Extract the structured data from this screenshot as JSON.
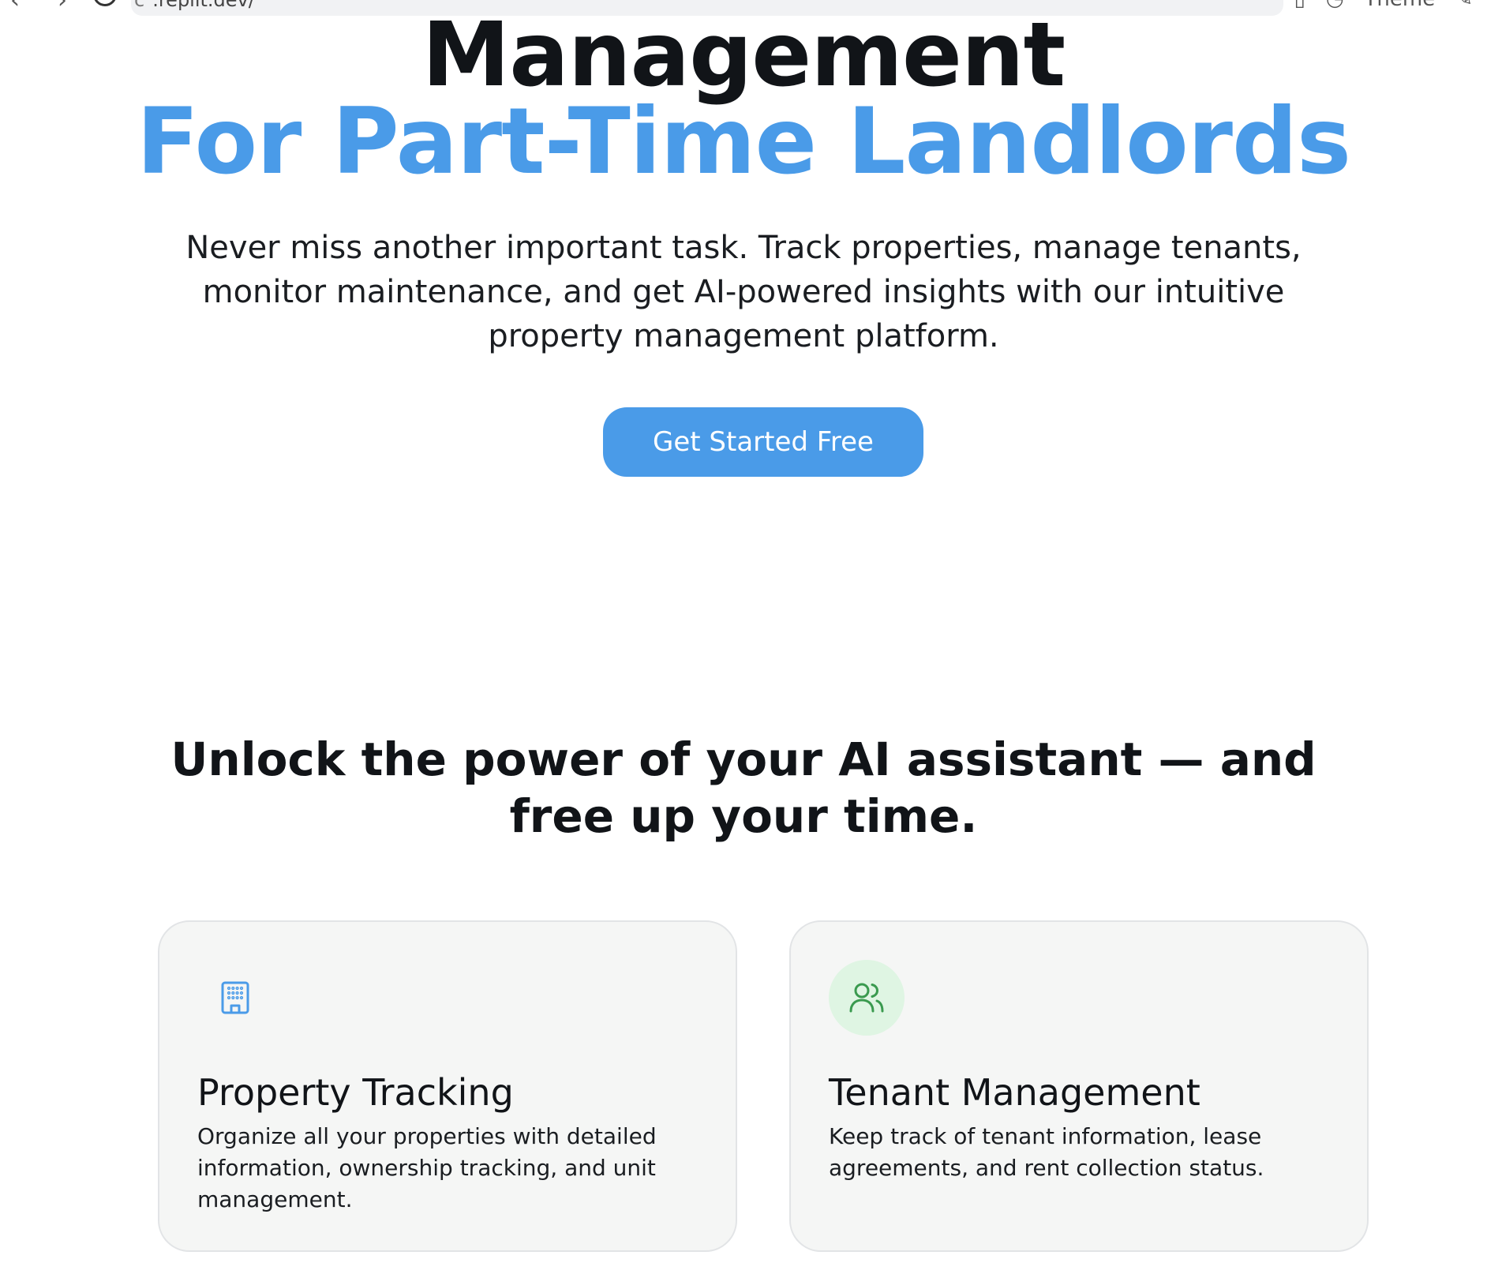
{
  "browser": {
    "address": ".replit.dev/",
    "theme_label": "Theme"
  },
  "hero": {
    "title_line1": "Management",
    "title_line2": "For Part-Time Landlords",
    "subtitle": "Never miss another important task. Track properties, manage tenants, monitor maintenance, and get AI-powered insights with our intuitive property management platform.",
    "cta_label": "Get Started Free"
  },
  "features": {
    "heading": "Unlock the power of your AI assistant — and free up your time.",
    "cards": [
      {
        "icon": "building-icon",
        "title": "Property Tracking",
        "description": "Organize all your properties with detailed information, ownership tracking, and unit management."
      },
      {
        "icon": "users-icon",
        "title": "Tenant Management",
        "description": "Keep track of tenant information, lease agreements, and rent collection status."
      }
    ]
  },
  "colors": {
    "accent": "#4a9be8",
    "heading": "#111418",
    "card_bg": "#f5f6f5",
    "tenant_icon_bg": "#dff5e3",
    "tenant_icon": "#3a9a4f"
  }
}
